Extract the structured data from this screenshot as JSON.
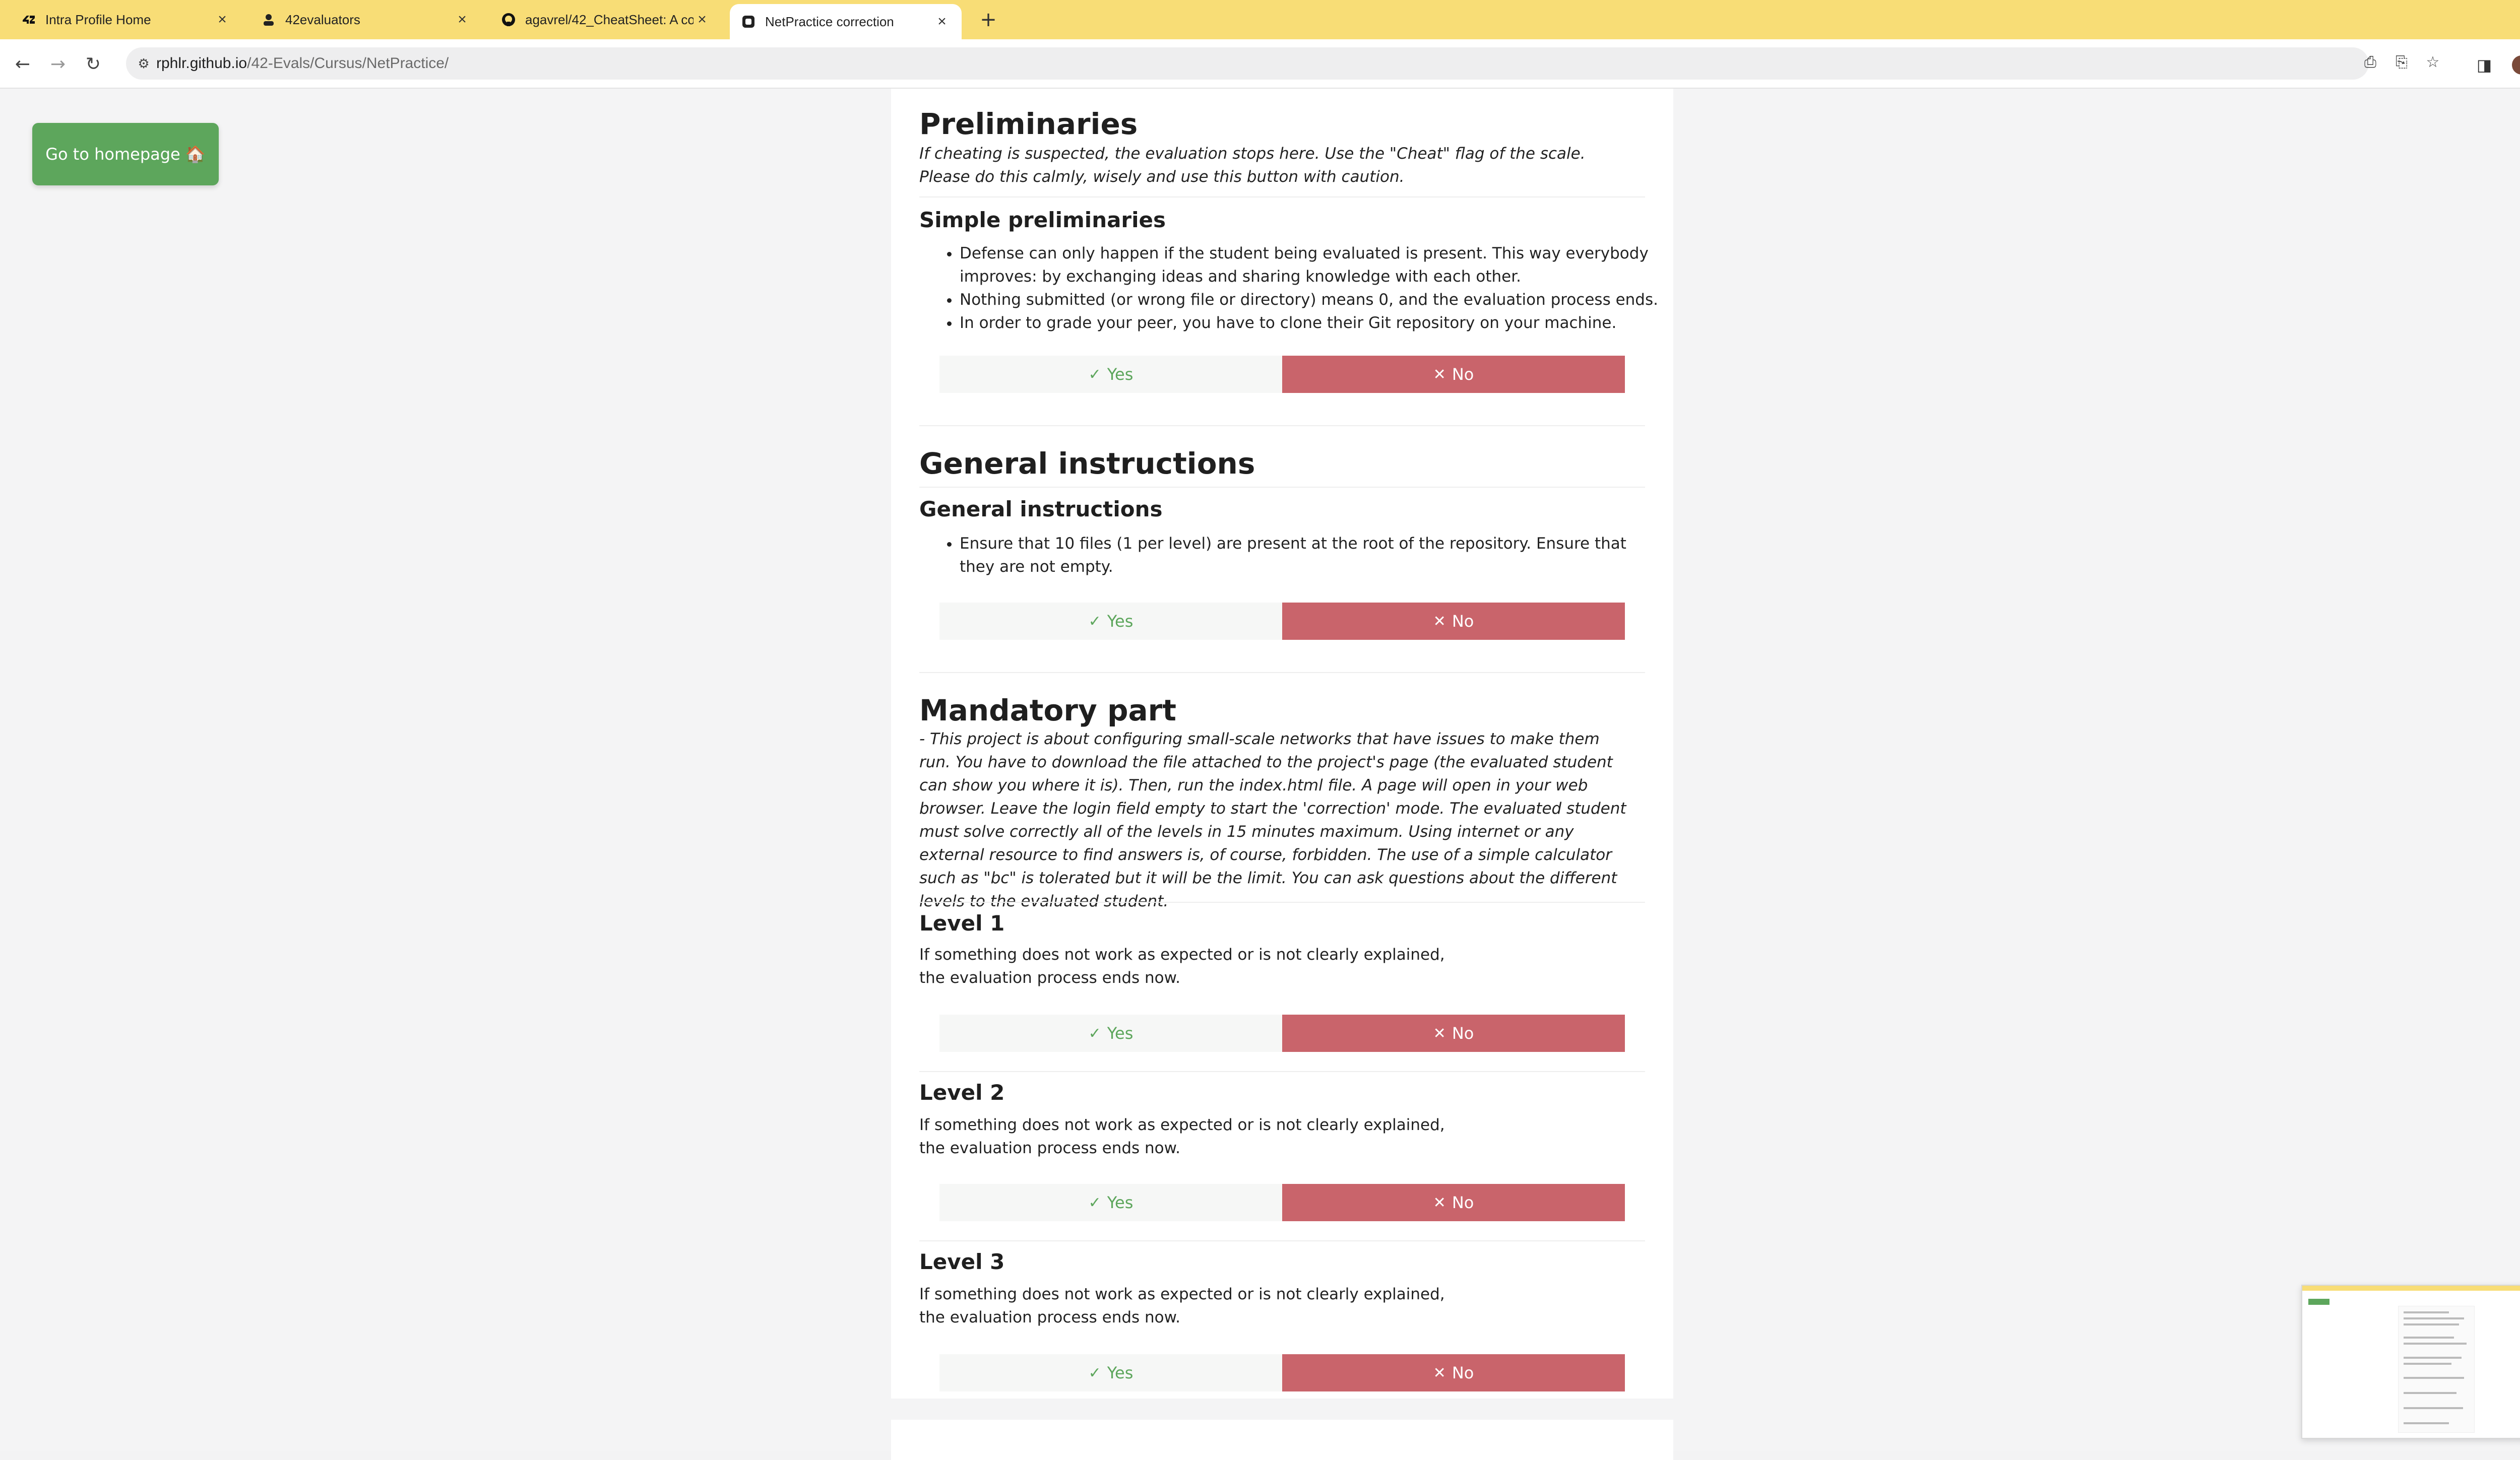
{
  "browser": {
    "tabs": [
      {
        "title": "Intra Profile Home",
        "icon": "42-icon"
      },
      {
        "title": "42evaluators",
        "icon": "person-icon"
      },
      {
        "title": "agavrel/42_CheatSheet: A co",
        "icon": "github-icon"
      },
      {
        "title": "NetPractice correction",
        "icon": "site-icon"
      }
    ],
    "url_host": "rphlr.github.io",
    "url_path": "/42-Evals/Cursus/NetPractice/"
  },
  "page": {
    "home_button": "Go to homepage 🏠",
    "yes_label": "Yes",
    "no_label": "No",
    "sections": {
      "preliminaries": {
        "title": "Preliminaries",
        "intro": "If cheating is suspected, the evaluation stops here. Use the \"Cheat\" flag of the scale. Please do this calmly, wisely and use this button with caution.",
        "sub_title": "Simple preliminaries",
        "bullets": [
          "Defense can only happen if the student being evaluated is present. This way everybody improves: by exchanging ideas and sharing knowledge with each other.",
          "Nothing submitted (or wrong file or directory) means 0, and the evaluation process ends.",
          "In order to grade your peer, you have to clone their Git repository on your machine."
        ]
      },
      "general": {
        "title": "General instructions",
        "sub_title": "General instructions",
        "bullets": [
          "Ensure that 10 files (1 per level) are present at the root of the repository. Ensure that they are not empty."
        ]
      },
      "mandatory": {
        "title": "Mandatory part",
        "intro": "- This project is about configuring small-scale networks that have issues to make them run. You have to download the file attached to the project's page (the evaluated student can show you where it is). Then, run the index.html file. A page will open in your web browser. Leave the login field empty to start the 'correction' mode. The evaluated student must solve correctly all of the levels in 15 minutes maximum. Using internet or any external resource to find answers is, of course, forbidden. The use of a simple calculator such as \"bc\" is tolerated but it will be the limit. You can ask questions about the different levels to the evaluated student.",
        "levels": [
          {
            "title": "Level 1",
            "text": "If something does not work as expected or is not clearly explained, the evaluation process ends now."
          },
          {
            "title": "Level 2",
            "text": "If something does not work as expected or is not clearly explained, the evaluation process ends now."
          },
          {
            "title": "Level 3",
            "text": "If something does not work as expected or is not clearly explained, the evaluation process ends now."
          }
        ]
      }
    }
  },
  "colors": {
    "tabbar": "#f8dd76",
    "home_button": "#5da65c",
    "yes_text": "#5da65c",
    "no_bg": "#c9646b"
  }
}
